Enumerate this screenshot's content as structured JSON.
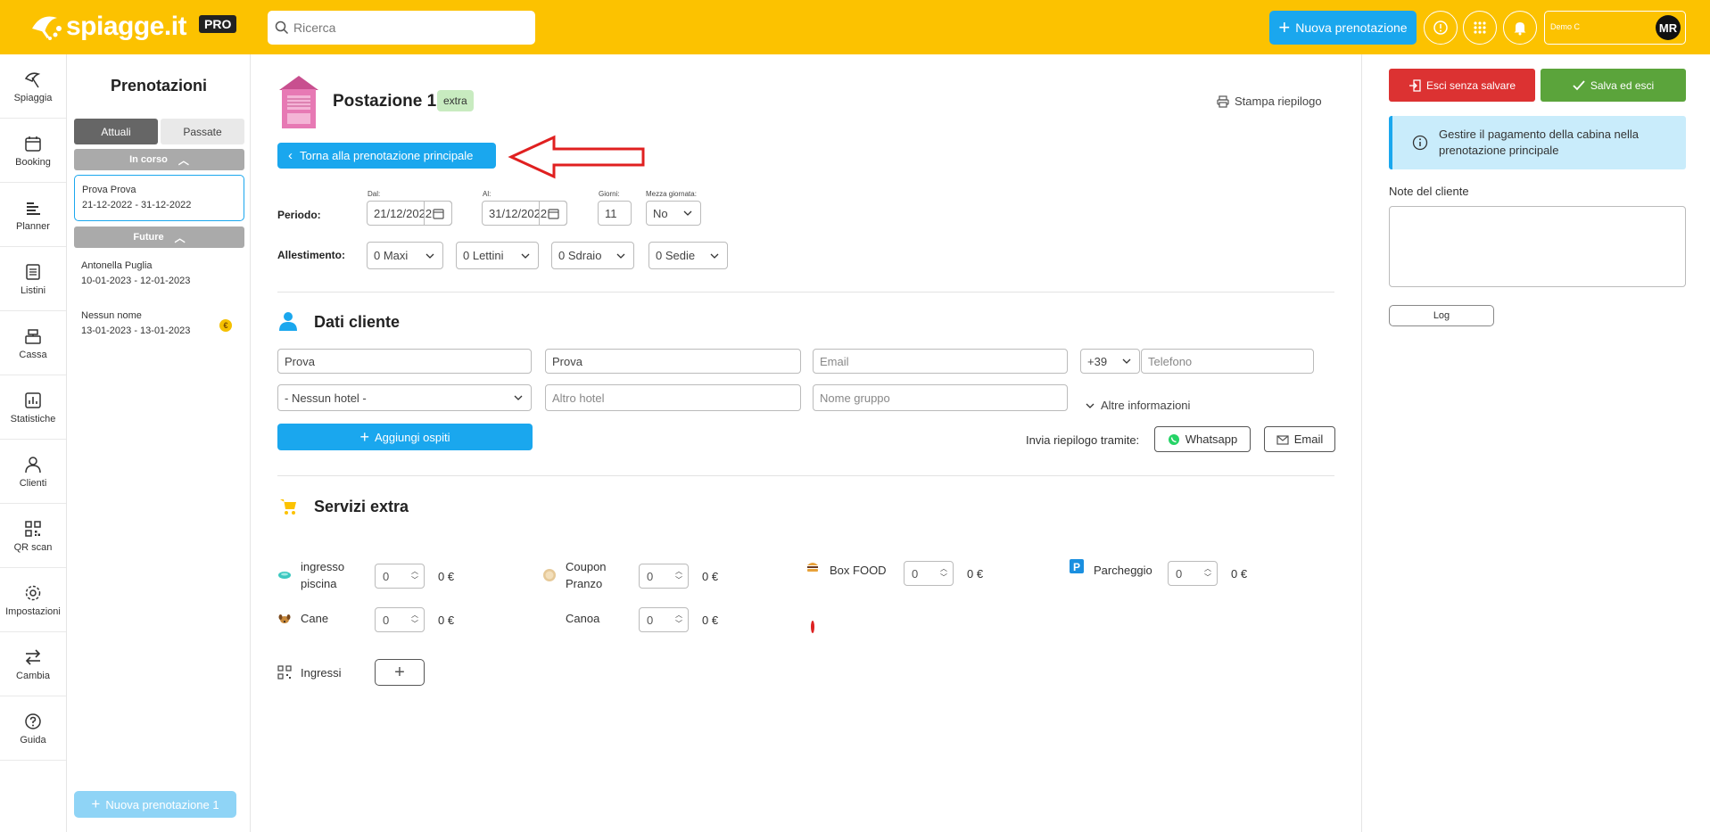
{
  "header": {
    "brand": "spiagge.it",
    "pro_badge": "PRO",
    "search_placeholder": "Ricerca",
    "new_booking_label": "Nuova prenotazione",
    "user_name": "Demo C",
    "avatar_initials": "MR"
  },
  "nav": {
    "items": [
      {
        "label": "Spiaggia",
        "icon": "beach-umbrella-icon"
      },
      {
        "label": "Booking",
        "icon": "calendar-icon"
      },
      {
        "label": "Planner",
        "icon": "planner-icon"
      },
      {
        "label": "Listini",
        "icon": "price-list-icon"
      },
      {
        "label": "Cassa",
        "icon": "cash-register-icon"
      },
      {
        "label": "Statistiche",
        "icon": "stats-icon"
      },
      {
        "label": "Clienti",
        "icon": "user-icon"
      },
      {
        "label": "QR scan",
        "icon": "qr-code-icon"
      },
      {
        "label": "Impostazioni",
        "icon": "gear-icon"
      },
      {
        "label": "Cambia",
        "icon": "swap-icon"
      },
      {
        "label": "Guida",
        "icon": "help-icon"
      }
    ]
  },
  "bookings": {
    "title": "Prenotazioni",
    "tab_current": "Attuali",
    "tab_past": "Passate",
    "group_in_progress": "In corso",
    "group_future": "Future",
    "current": [
      {
        "name": "Prova Prova",
        "dates": "21-12-2022 - 31-12-2022"
      }
    ],
    "future": [
      {
        "name": "Antonella Puglia",
        "dates": "10-01-2023 - 12-01-2023"
      },
      {
        "name": "Nessun nome",
        "dates": "13-01-2023 - 13-01-2023",
        "badge": "€"
      }
    ],
    "new_booking_label": "Nuova prenotazione 1"
  },
  "main": {
    "post_title": "Postazione 1",
    "extra_badge": "extra",
    "print_label": "Stampa riepilogo",
    "back_label": "Torna alla prenotazione principale",
    "period": {
      "label": "Periodo:",
      "from_label": "Dal:",
      "from_value": "21/12/2022",
      "to_label": "Al:",
      "to_value": "31/12/2022",
      "days_label": "Giorni:",
      "days_value": "11",
      "half_day_label": "Mezza giornata:",
      "half_day_value": "No"
    },
    "setup": {
      "label": "Allestimento:",
      "maxi": "0 Maxi",
      "lettini": "0 Lettini",
      "sdraio": "0 Sdraio",
      "sedie": "0 Sedie"
    },
    "customer": {
      "title": "Dati cliente",
      "first_name": "Prova",
      "last_name": "Prova",
      "email_placeholder": "Email",
      "prefix": "+39",
      "phone_placeholder": "Telefono",
      "hotel_select": "- Nessun hotel -",
      "other_hotel_placeholder": "Altro hotel",
      "group_placeholder": "Nome gruppo",
      "more_info": "Altre informazioni",
      "add_guests": "Aggiungi ospiti",
      "send_summary_label": "Invia riepilogo tramite:",
      "whatsapp": "Whatsapp",
      "email_btn": "Email"
    },
    "extras": {
      "title": "Servizi extra",
      "items": [
        {
          "label": "ingresso piscina",
          "qty": "0",
          "price": "0 €",
          "icon": "pool-icon"
        },
        {
          "label": "Coupon Pranzo",
          "qty": "0",
          "price": "0 €",
          "icon": "coupon-icon"
        },
        {
          "label": "Box FOOD",
          "qty": "0",
          "price": "0 €",
          "icon": "burger-icon"
        },
        {
          "label": "Parcheggio",
          "qty": "0",
          "price": "0 €",
          "icon": "parking-icon"
        },
        {
          "label": "Cane",
          "qty": "0",
          "price": "0 €",
          "icon": "dog-icon"
        },
        {
          "label": "Canoa",
          "qty": "0",
          "price": "0 €",
          "icon": "canoe-icon"
        }
      ],
      "ingressi_label": "Ingressi"
    }
  },
  "right": {
    "exit_label": "Esci senza salvare",
    "save_label": "Salva ed esci",
    "info_text": "Gestire il pagamento della cabina nella prenotazione principale",
    "notes_label": "Note del cliente",
    "log_label": "Log"
  },
  "colors": {
    "header_yellow": "#fcc200",
    "primary_blue": "#1aa7ee",
    "danger_red": "#dc3232",
    "success_green": "#5ba43b",
    "cabin_pink": "#e779b4"
  }
}
